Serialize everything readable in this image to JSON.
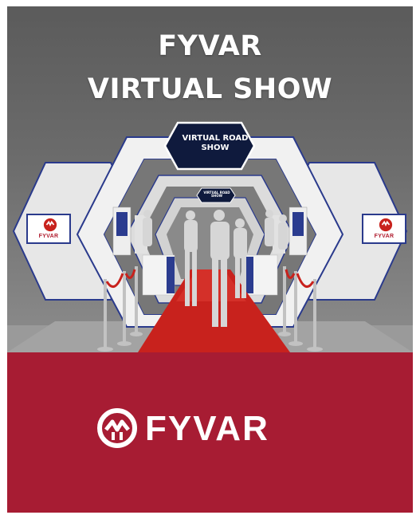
{
  "headline": {
    "line1": "FYVAR",
    "line2": "VIRTUAL SHOW"
  },
  "booth": {
    "sign_large": "VIRTUAL ROAD SHOW",
    "sign_small": "VIRTUAL ROAD SHOW",
    "panel_brand": "FYVAR"
  },
  "brand": {
    "wordmark": "FYVAR",
    "band_color": "#a71c33",
    "accent_blue": "#2a3a8c",
    "carpet_color": "#c8221d"
  }
}
